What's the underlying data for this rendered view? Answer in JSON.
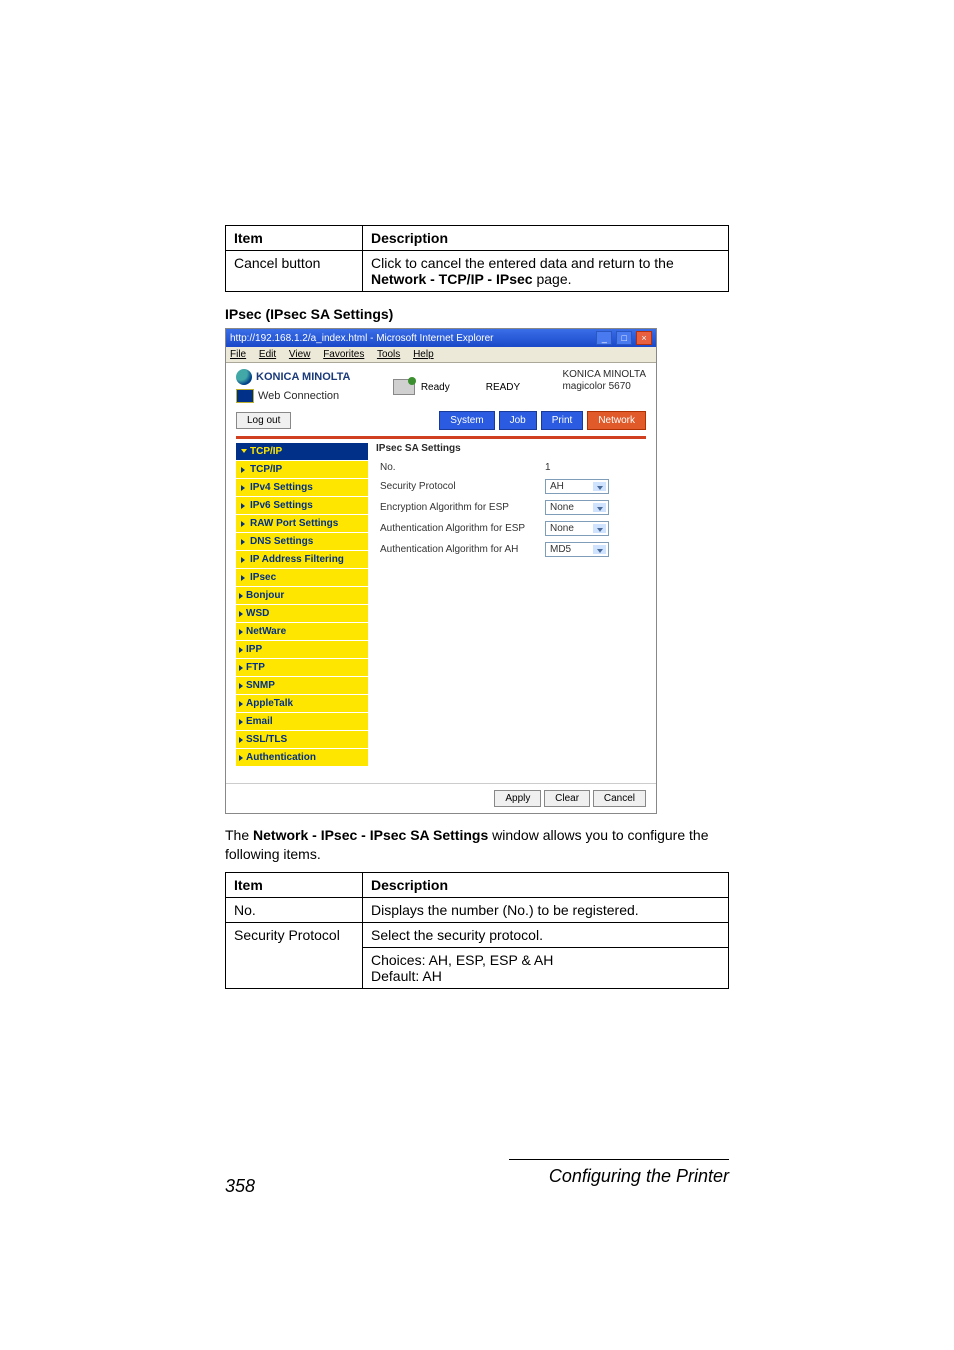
{
  "table1": {
    "headers": [
      "Item",
      "Description"
    ],
    "rows": [
      {
        "item": "Cancel button",
        "desc_pre": "Click to cancel the entered data and return to the ",
        "desc_bold": "Network - TCP/IP - IPsec",
        "desc_post": " page."
      }
    ]
  },
  "heading1": "IPsec (IPsec SA Settings)",
  "screenshot": {
    "title": "http://192.168.1.2/a_index.html - Microsoft Internet Explorer",
    "menus": [
      "File",
      "Edit",
      "View",
      "Favorites",
      "Tools",
      "Help"
    ],
    "brand": "KONICA MINOLTA",
    "connection": "Web Connection",
    "ready_label": "Ready",
    "ready_status": "READY",
    "device_line1": "KONICA MINOLTA",
    "device_line2": "magicolor 5670",
    "logout": "Log out",
    "tabs": [
      "System",
      "Job",
      "Print",
      "Network"
    ],
    "active_tab_index": 3,
    "nav": [
      {
        "label": "TCP/IP",
        "class": "top"
      },
      {
        "label": "TCP/IP",
        "class": "l2"
      },
      {
        "label": "IPv4 Settings",
        "class": "l2"
      },
      {
        "label": "IPv6 Settings",
        "class": "l2"
      },
      {
        "label": "RAW Port Settings",
        "class": "l2"
      },
      {
        "label": "DNS Settings",
        "class": "l2"
      },
      {
        "label": "IP Address Filtering",
        "class": "l2"
      },
      {
        "label": "IPsec",
        "class": "l2"
      },
      {
        "label": "Bonjour",
        "class": "l1"
      },
      {
        "label": "WSD",
        "class": "l1"
      },
      {
        "label": "NetWare",
        "class": "l1"
      },
      {
        "label": "IPP",
        "class": "l1"
      },
      {
        "label": "FTP",
        "class": "l1"
      },
      {
        "label": "SNMP",
        "class": "l1"
      },
      {
        "label": "AppleTalk",
        "class": "l1"
      },
      {
        "label": "Email",
        "class": "l1"
      },
      {
        "label": "SSL/TLS",
        "class": "l1"
      },
      {
        "label": "Authentication",
        "class": "l1"
      }
    ],
    "panel_heading": "IPsec SA Settings",
    "fields": [
      {
        "label": "No.",
        "value": "1",
        "type": "text"
      },
      {
        "label": "Security Protocol",
        "value": "AH",
        "type": "select"
      },
      {
        "label": "Encryption Algorithm for ESP",
        "value": "None",
        "type": "select"
      },
      {
        "label": "Authentication Algorithm for ESP",
        "value": "None",
        "type": "select"
      },
      {
        "label": "Authentication Algorithm for AH",
        "value": "MD5",
        "type": "select"
      }
    ],
    "footer_buttons": [
      "Apply",
      "Clear",
      "Cancel"
    ]
  },
  "body_text": {
    "pre": "The ",
    "bold": "Network - IPsec - IPsec SA Settings",
    "post": " window allows you to configure the following items."
  },
  "table2": {
    "headers": [
      "Item",
      "Description"
    ],
    "rows": [
      {
        "item": "No.",
        "lines": [
          "Displays the number (No.) to be registered."
        ]
      },
      {
        "item": "Security Protocol",
        "lines": [
          "Select the security protocol.",
          "Choices: AH, ESP, ESP & AH\nDefault:  AH"
        ]
      }
    ]
  },
  "footer": {
    "page_number": "358",
    "section": "Configuring the Printer"
  }
}
